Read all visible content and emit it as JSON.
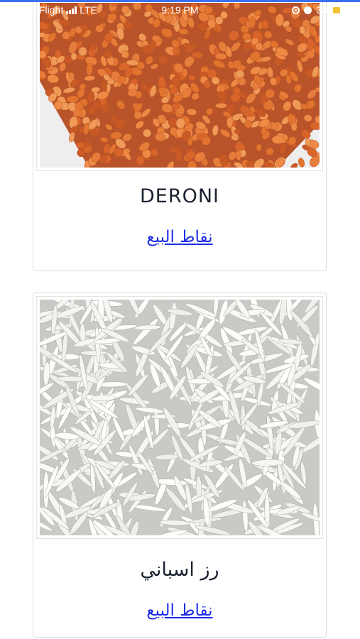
{
  "status_bar": {
    "carrier": "Flight",
    "network": "LTE",
    "time": "9:19 PM",
    "battery": "33"
  },
  "colors": {
    "link": "#1d2ee6",
    "title": "#1b2230",
    "lentil": "#e2742f",
    "rice": "#ffffff"
  },
  "products": [
    {
      "name": "DERONI",
      "link_label": "نقاط البيع",
      "image": "red-lentils-photo"
    },
    {
      "name": "رز اسباني",
      "link_label": "نقاط البيع",
      "image": "basmati-rice-photo"
    }
  ]
}
